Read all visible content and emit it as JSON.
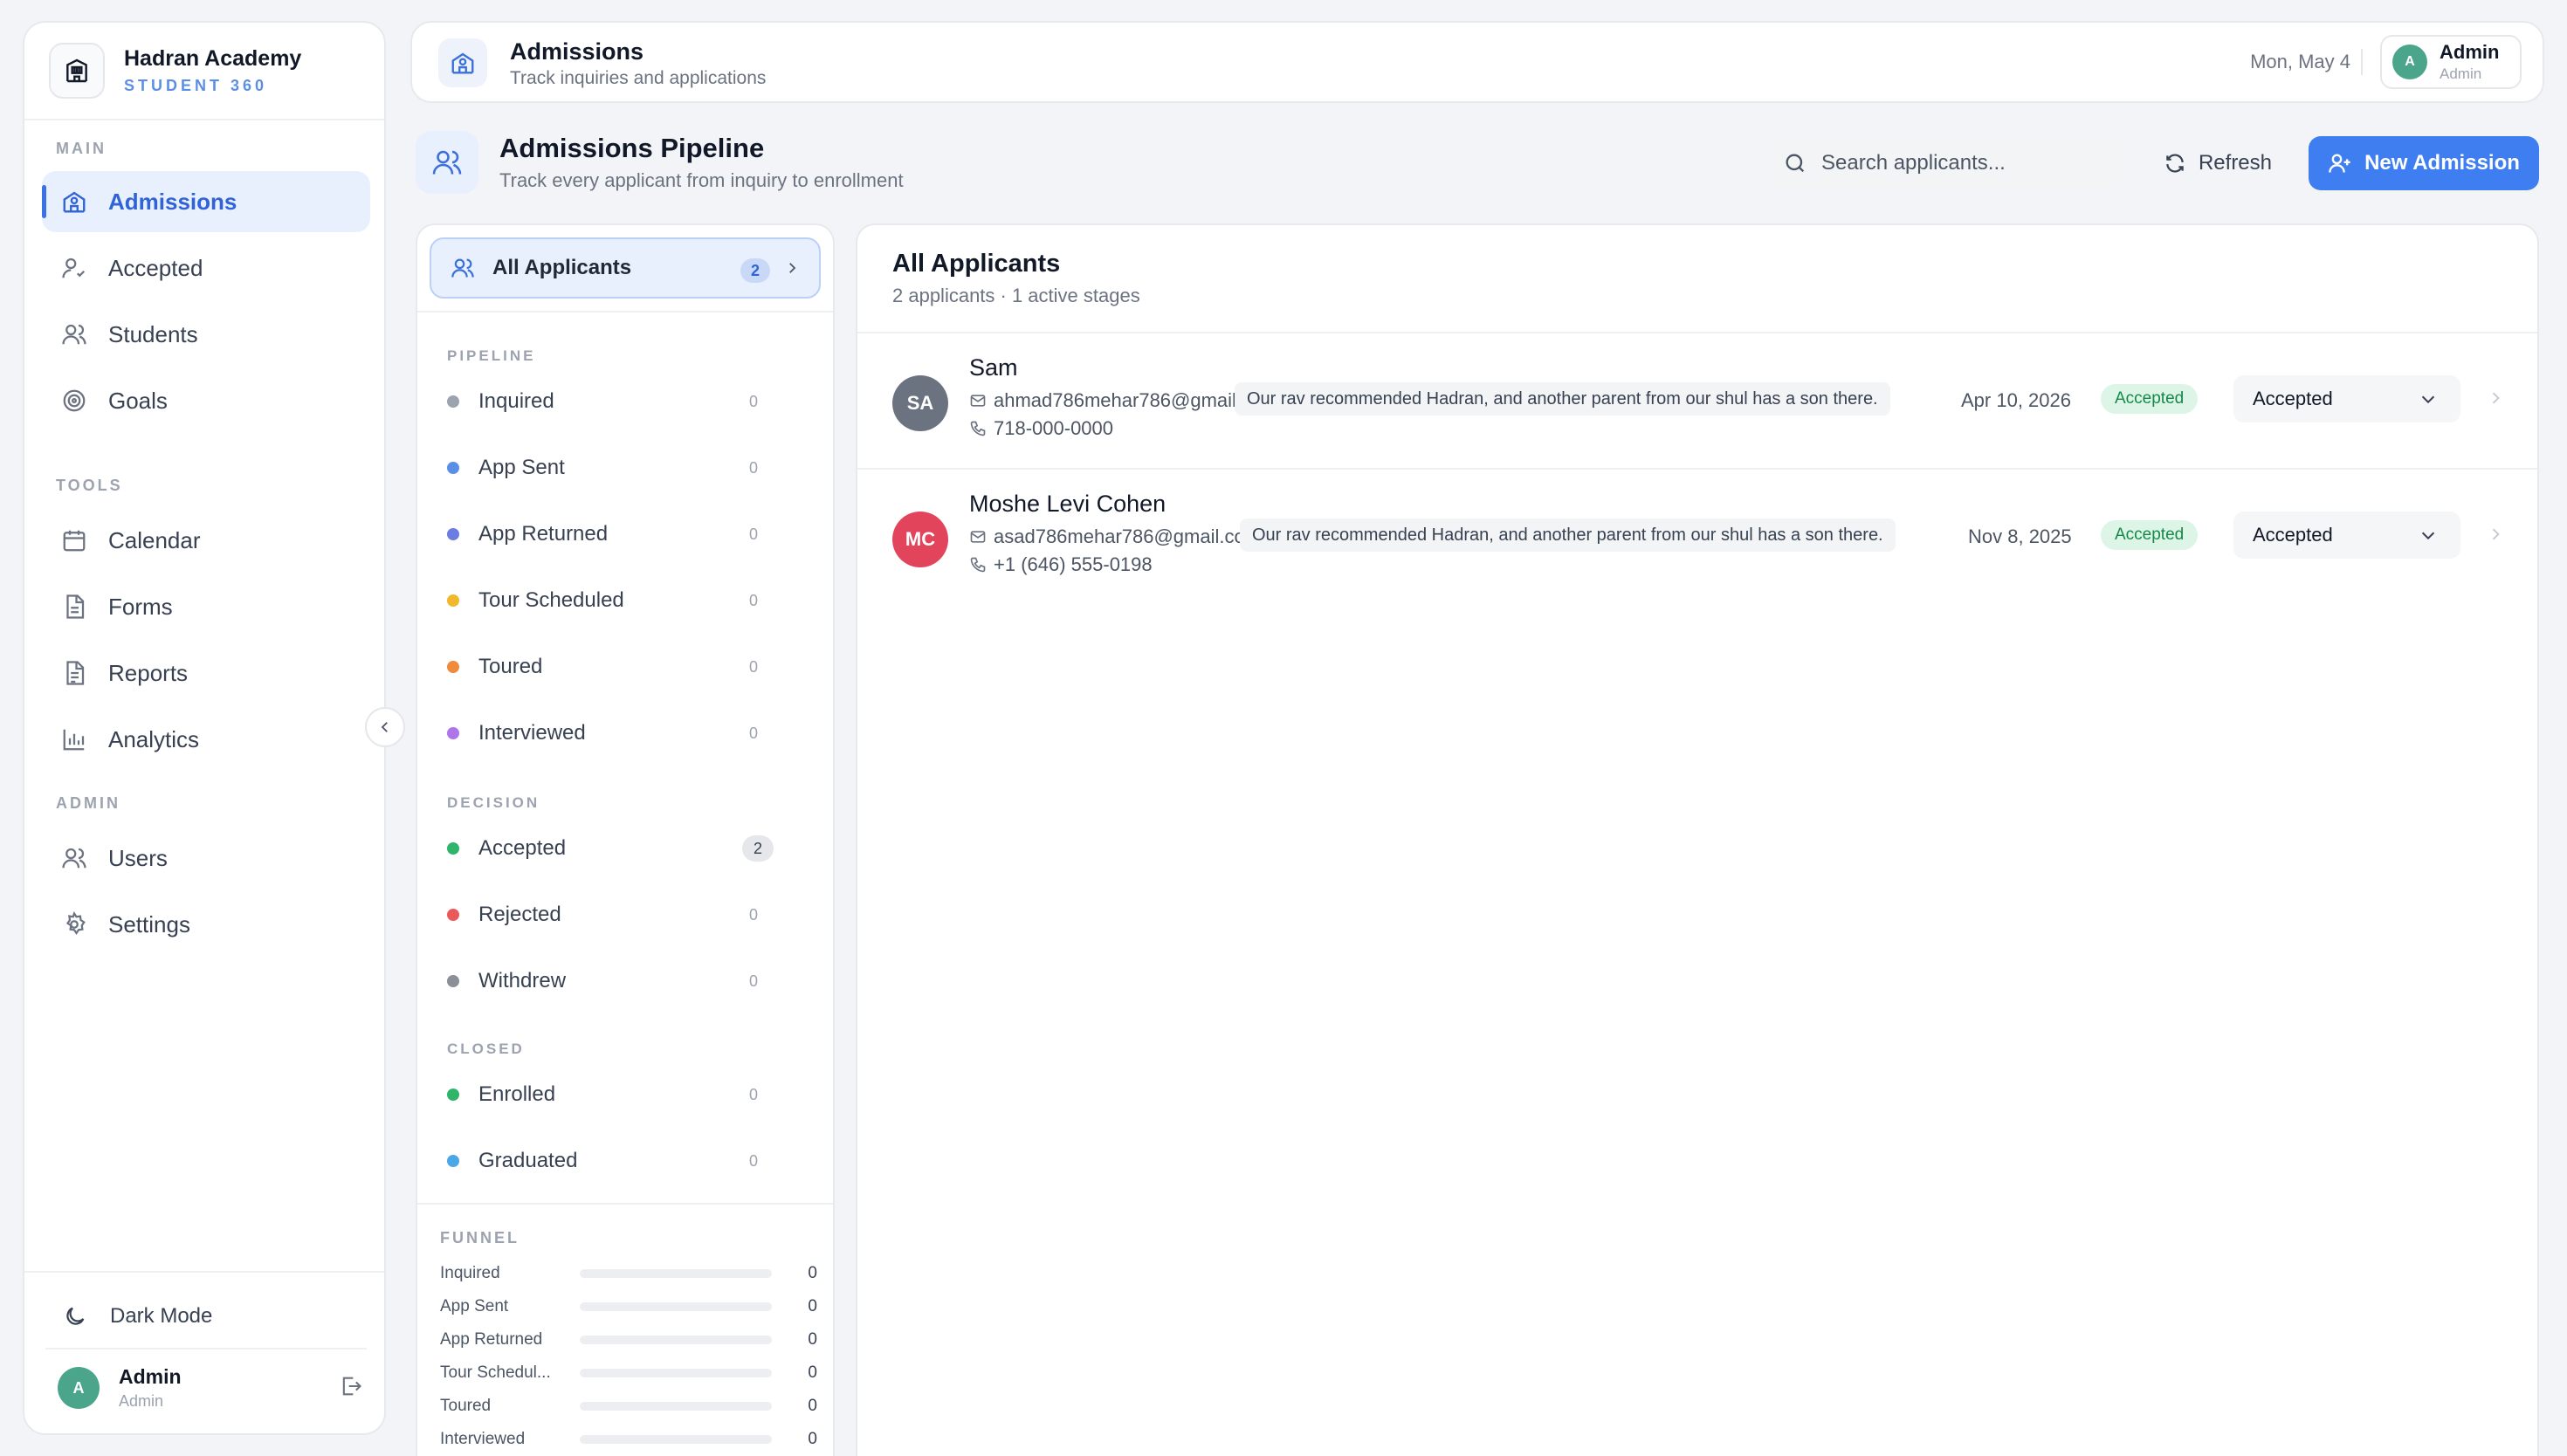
{
  "brand": {
    "name": "Hadran Academy",
    "subtitle": "STUDENT 360"
  },
  "sidebar": {
    "sections": {
      "main": "MAIN",
      "tools": "TOOLS",
      "admin": "ADMIN"
    },
    "items": [
      {
        "label": "Admissions",
        "icon": "school-icon",
        "active": true
      },
      {
        "label": "Accepted",
        "icon": "user-check-icon"
      },
      {
        "label": "Students",
        "icon": "users-icon"
      },
      {
        "label": "Goals",
        "icon": "target-icon"
      },
      {
        "label": "Calendar",
        "icon": "calendar-icon"
      },
      {
        "label": "Forms",
        "icon": "file-icon"
      },
      {
        "label": "Reports",
        "icon": "report-icon"
      },
      {
        "label": "Analytics",
        "icon": "bar-chart-icon"
      },
      {
        "label": "Users",
        "icon": "users-icon"
      },
      {
        "label": "Settings",
        "icon": "gear-icon"
      }
    ],
    "dark_mode_label": "Dark Mode",
    "user": {
      "initial": "A",
      "name": "Admin",
      "role": "Admin"
    }
  },
  "topbar": {
    "title": "Admissions",
    "subtitle": "Track inquiries and applications",
    "date": "Mon, May 4",
    "user": {
      "initial": "A",
      "name": "Admin",
      "role": "Admin"
    }
  },
  "page": {
    "title": "Admissions Pipeline",
    "subtitle": "Track every applicant from inquiry to enrollment",
    "search_placeholder": "Search applicants...",
    "refresh_label": "Refresh",
    "new_label": "New Admission"
  },
  "stages": {
    "all_label": "All Applicants",
    "all_count": "2",
    "groups": [
      {
        "label": "PIPELINE",
        "items": [
          {
            "label": "Inquired",
            "count": "0",
            "color": "#9ca3af"
          },
          {
            "label": "App Sent",
            "count": "0",
            "color": "#5b8fe6"
          },
          {
            "label": "App Returned",
            "count": "0",
            "color": "#6b7de0"
          },
          {
            "label": "Tour Scheduled",
            "count": "0",
            "color": "#f1b82d"
          },
          {
            "label": "Toured",
            "count": "0",
            "color": "#f08a3c"
          },
          {
            "label": "Interviewed",
            "count": "0",
            "color": "#b074ea"
          }
        ]
      },
      {
        "label": "DECISION",
        "items": [
          {
            "label": "Accepted",
            "count": "2",
            "color": "#2fb56a"
          },
          {
            "label": "Rejected",
            "count": "0",
            "color": "#ea5a5a"
          },
          {
            "label": "Withdrew",
            "count": "0",
            "color": "#8b8f98"
          }
        ]
      },
      {
        "label": "CLOSED",
        "items": [
          {
            "label": "Enrolled",
            "count": "0",
            "color": "#2fb56a"
          },
          {
            "label": "Graduated",
            "count": "0",
            "color": "#4aa8e8"
          }
        ]
      }
    ],
    "funnel_title": "FUNNEL",
    "funnel": [
      {
        "label": "Inquired",
        "value": 0
      },
      {
        "label": "App Sent",
        "value": 0
      },
      {
        "label": "App Returned",
        "value": 0
      },
      {
        "label": "Tour Schedul...",
        "value": 0
      },
      {
        "label": "Toured",
        "value": 0
      },
      {
        "label": "Interviewed",
        "value": 0
      }
    ]
  },
  "applicants": {
    "title": "All Applicants",
    "subtitle": "2 applicants · 1 active stages",
    "rows": [
      {
        "initials": "SA",
        "avatar_color": "#6b7280",
        "name": "Sam",
        "email": "ahmad786mehar786@gmail.com",
        "phone": "718-000-0000",
        "note": "Our rav recommended Hadran, and another parent from our shul has a son there.",
        "date": "Apr 10, 2026",
        "status": "Accepted",
        "stage": "Accepted"
      },
      {
        "initials": "MC",
        "avatar_color": "#e2445c",
        "name": "Moshe Levi Cohen",
        "email": "asad786mehar786@gmail.com",
        "phone": "+1 (646) 555-0198",
        "note": "Our rav recommended Hadran, and another parent from our shul has a son there.",
        "date": "Nov 8, 2025",
        "status": "Accepted",
        "stage": "Accepted"
      }
    ]
  }
}
